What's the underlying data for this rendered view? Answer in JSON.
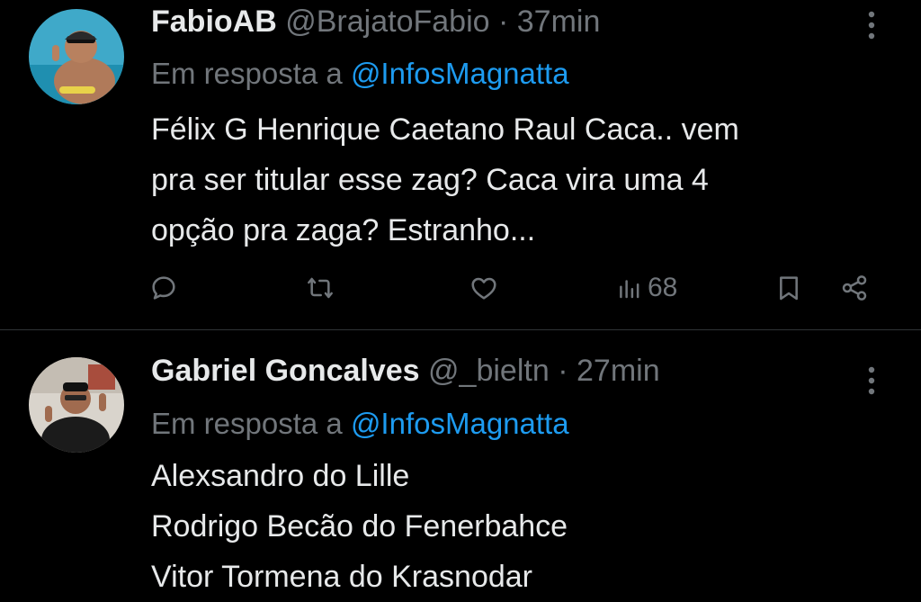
{
  "tweets": [
    {
      "name": "FabioAB",
      "handle": "@BrajatoFabio",
      "separator": "·",
      "time": "37min",
      "reply_prefix": "Em resposta a",
      "reply_to": "@InfosMagnatta",
      "lines": [
        "Félix G Henrique Caetano Raul Caca.. vem",
        "pra ser titular esse zag? Caca vira uma 4",
        "opção pra zaga? Estranho..."
      ],
      "views": "68"
    },
    {
      "name": "Gabriel Goncalves",
      "handle": "@_bieltn",
      "separator": "·",
      "time": "27min",
      "reply_prefix": "Em resposta a",
      "reply_to": "@InfosMagnatta",
      "lines": [
        "Alexsandro do Lille",
        "Rodrigo Becão do Fenerbahce",
        "Vitor Tormena do Krasnodar"
      ]
    }
  ],
  "icons": {
    "reply": "reply-icon",
    "retweet": "retweet-icon",
    "like": "like-icon",
    "views": "views-icon",
    "bookmark": "bookmark-icon",
    "share": "share-icon",
    "more": "more-vertical-icon"
  },
  "colors": {
    "background": "#000000",
    "text": "#e7e9ea",
    "secondary": "#71767b",
    "link": "#1d9bf0",
    "divider": "#2f3336"
  }
}
